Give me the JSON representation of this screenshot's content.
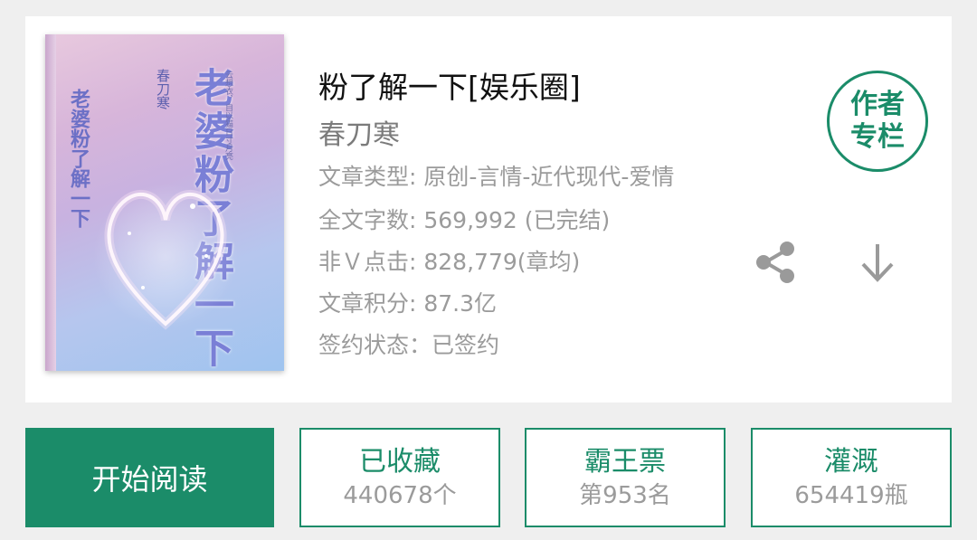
{
  "book": {
    "title": "粉了解一下[娱乐圈]",
    "author": "春刀寒",
    "cover": {
      "title_text": "老婆粉了解一下",
      "author_text": "春刀寒",
      "spine_text": "老婆粉了解一下",
      "small_note": "云想衣，自以猫日寸月亮"
    },
    "meta": {
      "type": "文章类型: 原创-言情-近代现代-爱情",
      "words": "全文字数: 569,992 (已完结)",
      "clicks": "非Ｖ点击: 828,779(章均)",
      "score": "文章积分: 87.3亿",
      "sign": "签约状态：已签约"
    },
    "badge": {
      "line1": "作者",
      "line2": "专栏"
    }
  },
  "icons": {
    "share": "share-icon",
    "download": "download-arrow-icon"
  },
  "actions": {
    "read": {
      "label": "开始阅读"
    },
    "collect": {
      "label": "已收藏",
      "value": "440678个"
    },
    "ticket": {
      "label": "霸王票",
      "value": "第953名"
    },
    "water": {
      "label": "灌溉",
      "value": "654419瓶"
    }
  },
  "colors": {
    "accent": "#1b8c69",
    "meta_text": "#9b9b9b",
    "background": "#efefef"
  }
}
